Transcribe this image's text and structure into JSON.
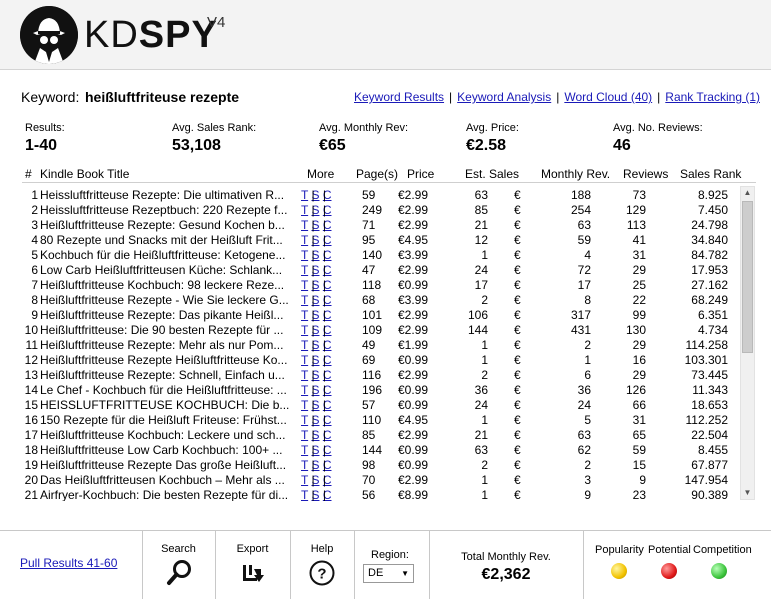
{
  "app": {
    "logo_prefix": "KD",
    "logo_main": "SPY",
    "version": "V4"
  },
  "keyword": {
    "label": "Keyword:",
    "value": "heißluftfriteuse rezepte"
  },
  "links": [
    {
      "label": "Keyword Results"
    },
    {
      "label": "Keyword Analysis"
    },
    {
      "label": "Word Cloud (40)"
    },
    {
      "label": "Rank Tracking (1)"
    }
  ],
  "stats": {
    "results": {
      "label": "Results:",
      "value": "1-40"
    },
    "avg_sales_rank": {
      "label": "Avg. Sales Rank:",
      "value": "53,108"
    },
    "avg_monthly_rev": {
      "label": "Avg. Monthly Rev:",
      "value": "€65"
    },
    "avg_price": {
      "label": "Avg. Price:",
      "value": "€2.58"
    },
    "avg_reviews": {
      "label": "Avg. No. Reviews:",
      "value": "46"
    }
  },
  "table": {
    "headers": {
      "num": "#",
      "title": "Kindle Book Title",
      "more": "More",
      "pages": "Page(s)",
      "price": "Price",
      "sales": "Est. Sales",
      "rev": "Monthly Rev.",
      "reviews": "Reviews",
      "rank": "Sales Rank"
    },
    "more_links": {
      "t": "T",
      "s": "S",
      "c": "C",
      "sep": "|"
    },
    "currency": "€",
    "rows": [
      {
        "num": "1",
        "title": "Heissluftfritteuse Rezepte: Die ultimativen R...",
        "pages": "59",
        "price": "€2.99",
        "sales": "63",
        "rev": "188",
        "reviews": "73",
        "rank": "8.925"
      },
      {
        "num": "2",
        "title": "Heissluftfritteuse Rezeptbuch: 220 Rezepte f...",
        "pages": "249",
        "price": "€2.99",
        "sales": "85",
        "rev": "254",
        "reviews": "129",
        "rank": "7.450"
      },
      {
        "num": "3",
        "title": "Heißluftfritteuse Rezepte: Gesund Kochen b...",
        "pages": "71",
        "price": "€2.99",
        "sales": "21",
        "rev": "63",
        "reviews": "113",
        "rank": "24.798"
      },
      {
        "num": "4",
        "title": "80 Rezepte und Snacks mit der Heißluft Frit...",
        "pages": "95",
        "price": "€4.95",
        "sales": "12",
        "rev": "59",
        "reviews": "41",
        "rank": "34.840"
      },
      {
        "num": "5",
        "title": "Kochbuch für die Heißluftfritteuse: Ketogene...",
        "pages": "140",
        "price": "€3.99",
        "sales": "1",
        "rev": "4",
        "reviews": "31",
        "rank": "84.782"
      },
      {
        "num": "6",
        "title": "Low Carb Heißluftfritteusen Küche: Schlank...",
        "pages": "47",
        "price": "€2.99",
        "sales": "24",
        "rev": "72",
        "reviews": "29",
        "rank": "17.953"
      },
      {
        "num": "7",
        "title": "Heißluftfritteuse Kochbuch: 98 leckere Reze...",
        "pages": "118",
        "price": "€0.99",
        "sales": "17",
        "rev": "17",
        "reviews": "25",
        "rank": "27.162"
      },
      {
        "num": "8",
        "title": "Heißluftfritteuse Rezepte - Wie Sie leckere G...",
        "pages": "68",
        "price": "€3.99",
        "sales": "2",
        "rev": "8",
        "reviews": "22",
        "rank": "68.249"
      },
      {
        "num": "9",
        "title": "Heißluftfritteuse Rezepte: Das pikante Heißl...",
        "pages": "101",
        "price": "€2.99",
        "sales": "106",
        "rev": "317",
        "reviews": "99",
        "rank": "6.351"
      },
      {
        "num": "10",
        "title": "Heißluftfritteuse: Die 90 besten Rezepte für ...",
        "pages": "109",
        "price": "€2.99",
        "sales": "144",
        "rev": "431",
        "reviews": "130",
        "rank": "4.734"
      },
      {
        "num": "11",
        "title": "Heißluftfritteuse Rezepte: Mehr als nur Pom...",
        "pages": "49",
        "price": "€1.99",
        "sales": "1",
        "rev": "2",
        "reviews": "29",
        "rank": "114.258"
      },
      {
        "num": "12",
        "title": "Heißluftfritteuse Rezepte Heißluftfritteuse Ko...",
        "pages": "69",
        "price": "€0.99",
        "sales": "1",
        "rev": "1",
        "reviews": "16",
        "rank": "103.301"
      },
      {
        "num": "13",
        "title": "Heißluftfritteuse Rezepte: Schnell, Einfach u...",
        "pages": "116",
        "price": "€2.99",
        "sales": "2",
        "rev": "6",
        "reviews": "29",
        "rank": "73.445"
      },
      {
        "num": "14",
        "title": "Le Chef - Kochbuch für die Heißluftfritteuse: ...",
        "pages": "196",
        "price": "€0.99",
        "sales": "36",
        "rev": "36",
        "reviews": "126",
        "rank": "11.343"
      },
      {
        "num": "15",
        "title": "HEISSLUFTFRITTEUSE KOCHBUCH: Die b...",
        "pages": "57",
        "price": "€0.99",
        "sales": "24",
        "rev": "24",
        "reviews": "66",
        "rank": "18.653"
      },
      {
        "num": "16",
        "title": "150 Rezepte für die Heißluft Friteuse: Frühst...",
        "pages": "110",
        "price": "€4.95",
        "sales": "1",
        "rev": "5",
        "reviews": "31",
        "rank": "112.252"
      },
      {
        "num": "17",
        "title": "Heißluftfritteuse Kochbuch: Leckere und sch...",
        "pages": "85",
        "price": "€2.99",
        "sales": "21",
        "rev": "63",
        "reviews": "65",
        "rank": "22.504"
      },
      {
        "num": "18",
        "title": "Heißluftfritteuse Low Carb Kochbuch: 100+ ...",
        "pages": "144",
        "price": "€0.99",
        "sales": "63",
        "rev": "62",
        "reviews": "59",
        "rank": "8.455"
      },
      {
        "num": "19",
        "title": "Heißluftfritteuse Rezepte Das große Heißluft...",
        "pages": "98",
        "price": "€0.99",
        "sales": "2",
        "rev": "2",
        "reviews": "15",
        "rank": "67.877"
      },
      {
        "num": "20",
        "title": "Das Heißluftfritteusen Kochbuch – Mehr als ...",
        "pages": "70",
        "price": "€2.99",
        "sales": "1",
        "rev": "3",
        "reviews": "9",
        "rank": "147.954"
      },
      {
        "num": "21",
        "title": "Airfryer-Kochbuch: Die besten Rezepte für di...",
        "pages": "56",
        "price": "€8.99",
        "sales": "1",
        "rev": "9",
        "reviews": "23",
        "rank": "90.389"
      }
    ]
  },
  "footer": {
    "pull_label": "Pull Results 41-60",
    "search_label": "Search",
    "export_label": "Export",
    "help_label": "Help",
    "region_label": "Region:",
    "region_value": "DE",
    "tmr_label": "Total Monthly Rev.",
    "tmr_value": "€2,362",
    "popularity_label": "Popularity",
    "potential_label": "Potential",
    "competition_label": "Competition",
    "colors": {
      "popularity": "#f2c200",
      "potential": "#e01a1a",
      "competition": "#3cc43c"
    }
  }
}
